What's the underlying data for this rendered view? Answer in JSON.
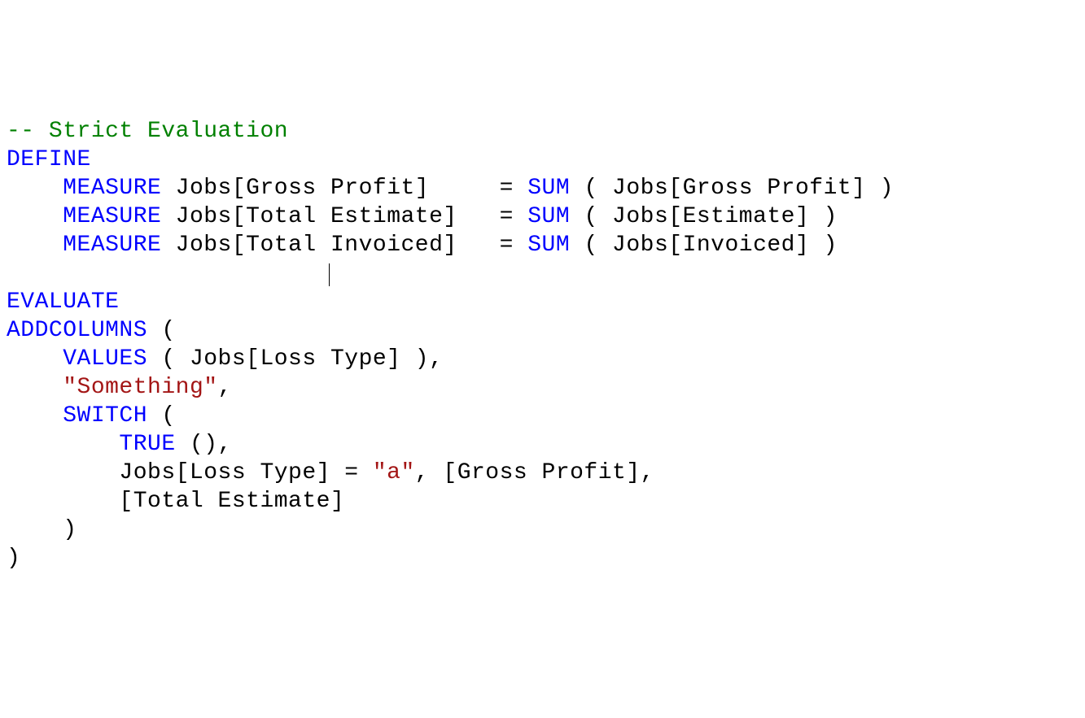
{
  "code": {
    "line1_comment": "-- Strict Evaluation",
    "line2_define": "DEFINE",
    "line3_measure": "    MEASURE",
    "line3_rest1": " Jobs[Gross Profit]     = ",
    "line3_sum": "SUM",
    "line3_rest2": " ( Jobs[Gross Profit] )",
    "line4_measure": "    MEASURE",
    "line4_rest1": " Jobs[Total Estimate]   = ",
    "line4_sum": "SUM",
    "line4_rest2": " ( Jobs[Estimate] )",
    "line5_measure": "    MEASURE",
    "line5_rest1": " Jobs[Total Invoiced]   = ",
    "line5_sum": "SUM",
    "line5_rest2": " ( Jobs[Invoiced] )",
    "line6_spaces": "                       ",
    "line7_evaluate": "EVALUATE",
    "line8_addcolumns": "ADDCOLUMNS",
    "line8_paren": " (",
    "line9_values": "    VALUES",
    "line9_rest": " ( Jobs[Loss Type] ),",
    "line10_indent": "    ",
    "line10_string": "\"Something\"",
    "line10_comma": ",",
    "line11_switch": "    SWITCH",
    "line11_paren": " (",
    "line12_true": "        TRUE",
    "line12_rest": " (),",
    "line13_indent": "        Jobs[Loss Type] = ",
    "line13_string": "\"a\"",
    "line13_rest": ", [Gross Profit],",
    "line14": "        [Total Estimate]",
    "line15": "    )",
    "line16": ")"
  }
}
